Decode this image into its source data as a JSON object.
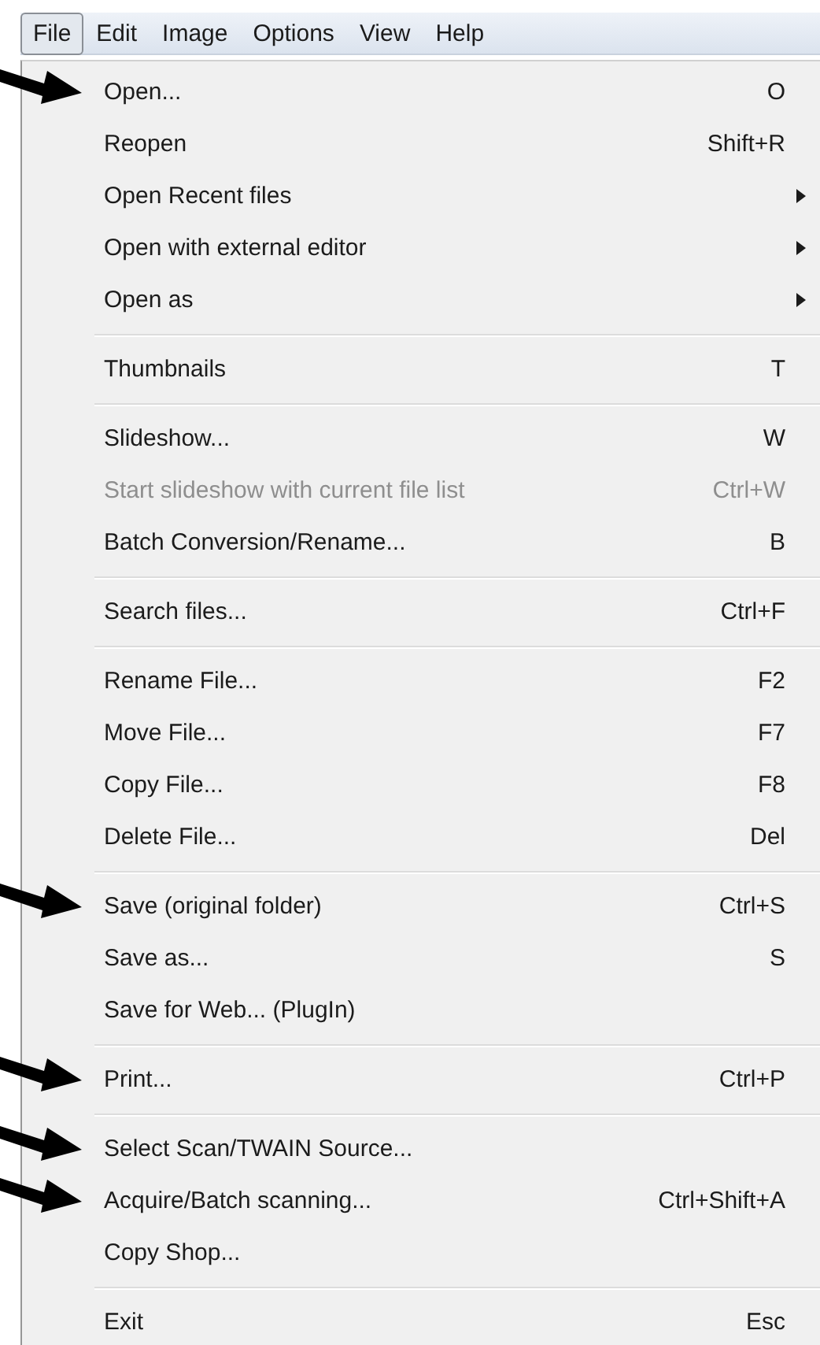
{
  "menu_bar": [
    {
      "label": "File",
      "selected": true
    },
    {
      "label": "Edit",
      "selected": false
    },
    {
      "label": "Image",
      "selected": false
    },
    {
      "label": "Options",
      "selected": false
    },
    {
      "label": "View",
      "selected": false
    },
    {
      "label": "Help",
      "selected": false
    }
  ],
  "menu": {
    "items": [
      {
        "kind": "item",
        "label": "Open...",
        "shortcut": "O",
        "disabled": false,
        "annotated": true
      },
      {
        "kind": "item",
        "label": "Reopen",
        "shortcut": "Shift+R",
        "disabled": false,
        "annotated": false
      },
      {
        "kind": "submenu",
        "label": "Open Recent files",
        "disabled": false,
        "annotated": false
      },
      {
        "kind": "submenu",
        "label": "Open with external editor",
        "disabled": false,
        "annotated": false
      },
      {
        "kind": "submenu",
        "label": "Open as",
        "disabled": false,
        "annotated": false
      },
      {
        "kind": "separator"
      },
      {
        "kind": "item",
        "label": "Thumbnails",
        "shortcut": "T",
        "disabled": false,
        "annotated": false
      },
      {
        "kind": "separator"
      },
      {
        "kind": "item",
        "label": "Slideshow...",
        "shortcut": "W",
        "disabled": false,
        "annotated": false
      },
      {
        "kind": "item",
        "label": "Start slideshow with current file list",
        "shortcut": "Ctrl+W",
        "disabled": true,
        "annotated": false
      },
      {
        "kind": "item",
        "label": "Batch Conversion/Rename...",
        "shortcut": "B",
        "disabled": false,
        "annotated": false
      },
      {
        "kind": "separator"
      },
      {
        "kind": "item",
        "label": "Search files...",
        "shortcut": "Ctrl+F",
        "disabled": false,
        "annotated": false
      },
      {
        "kind": "separator"
      },
      {
        "kind": "item",
        "label": "Rename File...",
        "shortcut": "F2",
        "disabled": false,
        "annotated": false
      },
      {
        "kind": "item",
        "label": "Move File...",
        "shortcut": "F7",
        "disabled": false,
        "annotated": false
      },
      {
        "kind": "item",
        "label": "Copy File...",
        "shortcut": "F8",
        "disabled": false,
        "annotated": false
      },
      {
        "kind": "item",
        "label": "Delete File...",
        "shortcut": "Del",
        "disabled": false,
        "annotated": false
      },
      {
        "kind": "separator"
      },
      {
        "kind": "item",
        "label": "Save (original folder)",
        "shortcut": "Ctrl+S",
        "disabled": false,
        "annotated": true
      },
      {
        "kind": "item",
        "label": "Save as...",
        "shortcut": "S",
        "disabled": false,
        "annotated": false
      },
      {
        "kind": "item",
        "label": "Save for Web... (PlugIn)",
        "disabled": false,
        "annotated": false
      },
      {
        "kind": "separator"
      },
      {
        "kind": "item",
        "label": "Print...",
        "shortcut": "Ctrl+P",
        "disabled": false,
        "annotated": true
      },
      {
        "kind": "separator"
      },
      {
        "kind": "item",
        "label": "Select Scan/TWAIN Source...",
        "disabled": false,
        "annotated": true
      },
      {
        "kind": "item",
        "label": "Acquire/Batch scanning...",
        "shortcut": "Ctrl+Shift+A",
        "disabled": false,
        "annotated": true
      },
      {
        "kind": "item",
        "label": "Copy Shop...",
        "disabled": false,
        "annotated": false
      },
      {
        "kind": "separator"
      },
      {
        "kind": "item",
        "label": "Exit",
        "shortcut": "Esc",
        "disabled": false,
        "annotated": false
      }
    ]
  }
}
